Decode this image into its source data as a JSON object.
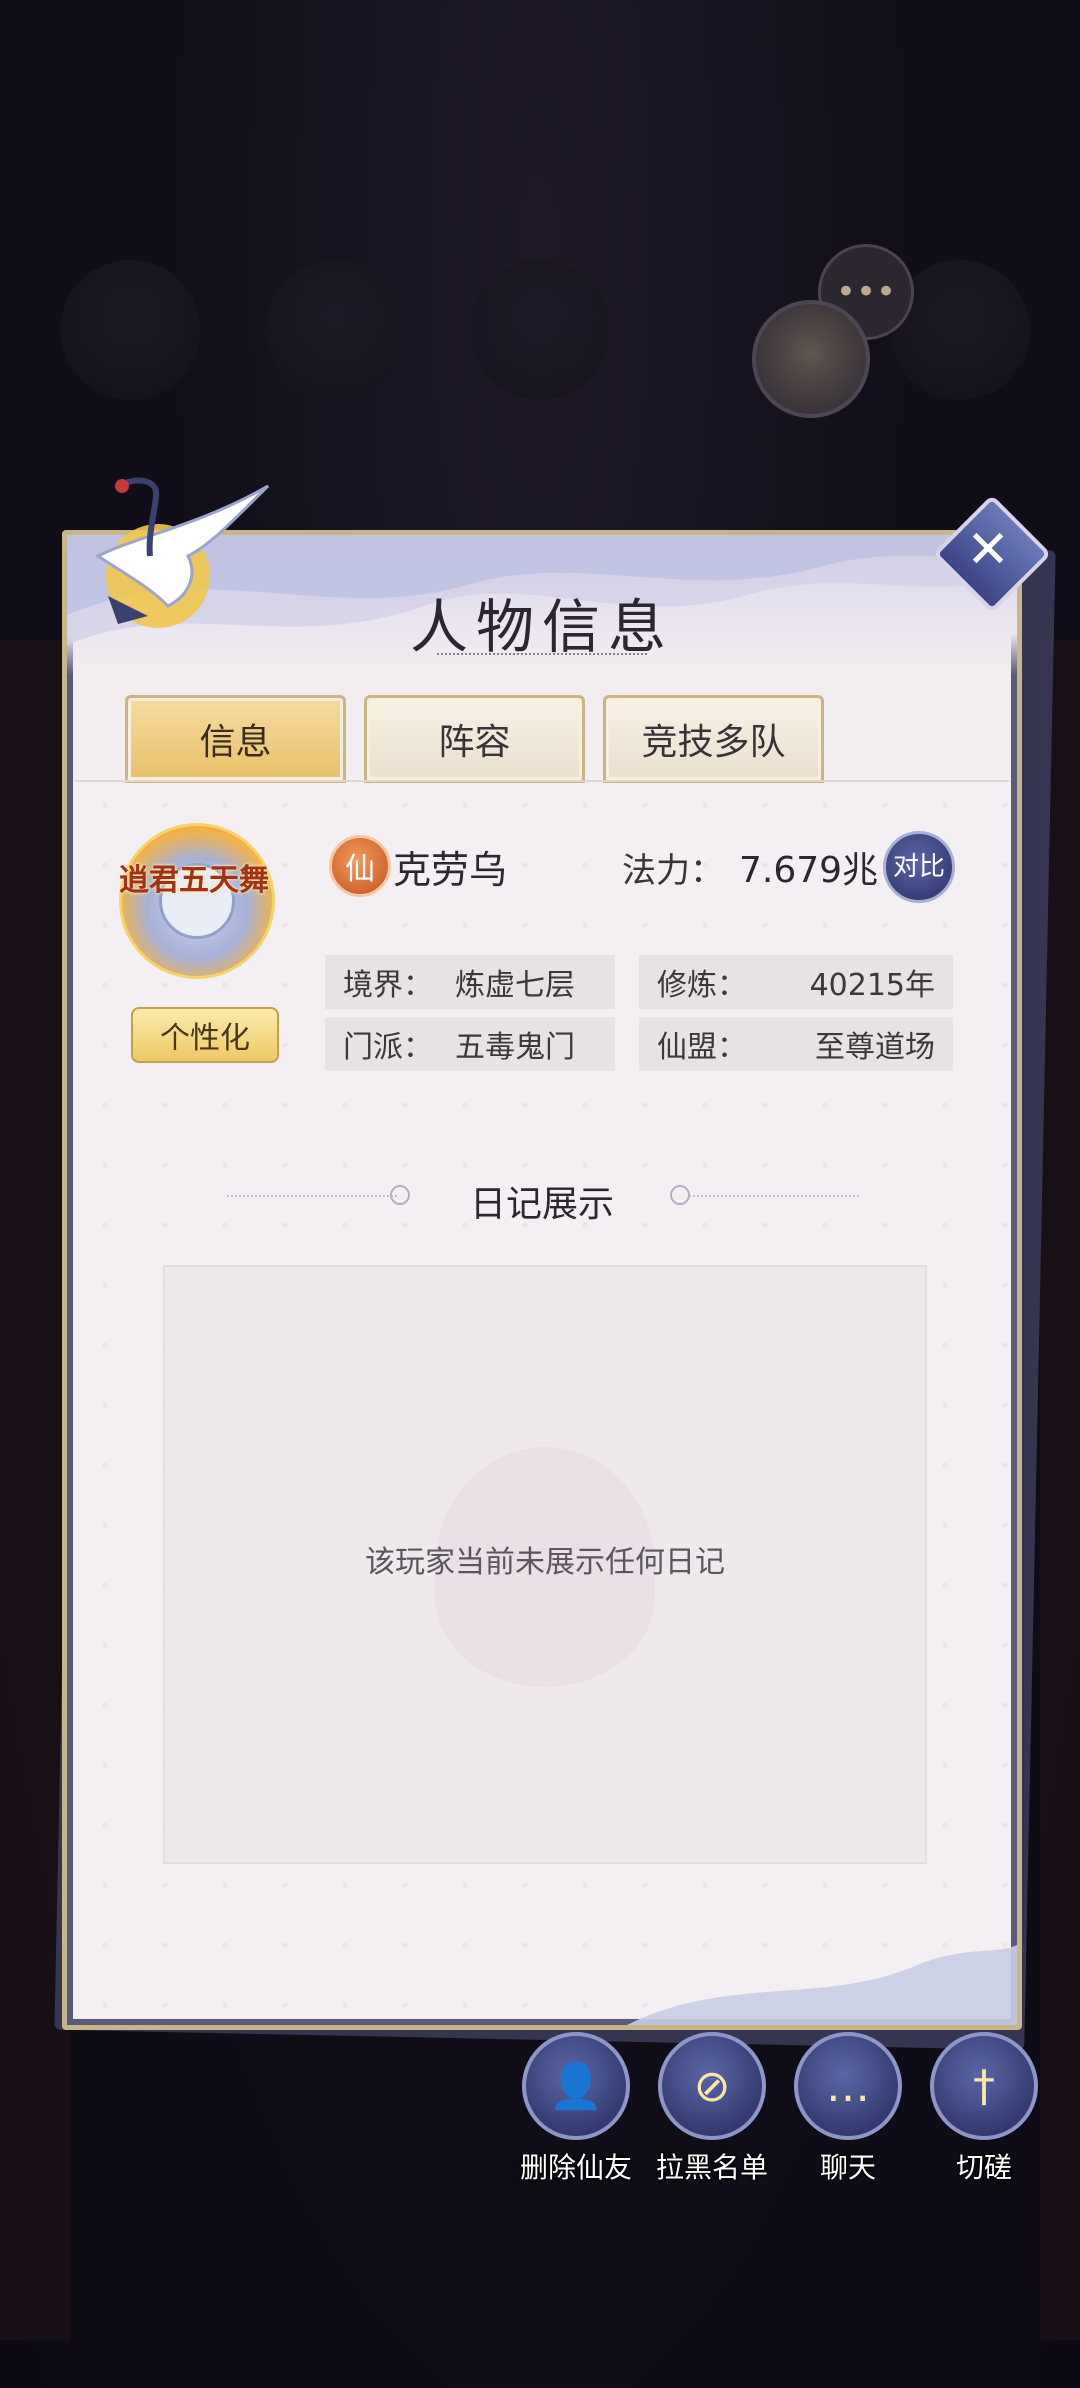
{
  "dialog": {
    "title": "人物信息",
    "tabs": [
      {
        "label": "信息",
        "active": true
      },
      {
        "label": "阵容",
        "active": false
      },
      {
        "label": "竞技多队",
        "active": false
      }
    ]
  },
  "profile": {
    "avatar_tag": "逍君五天舞",
    "personalize_label": "个性化",
    "badge": "仙",
    "name": "克劳乌",
    "power_label": "法力：",
    "power_value": "7.679兆",
    "compare_label": "对比",
    "fields": {
      "realm_label": "境界：",
      "realm_value": "炼虚七层",
      "cultivation_label": "修炼：",
      "cultivation_value": "40215年",
      "sect_label": "门派：",
      "sect_value": "五毒鬼门",
      "alliance_label": "仙盟：",
      "alliance_value": "至尊道场"
    }
  },
  "diary": {
    "title": "日记展示",
    "empty_text": "该玩家当前未展示任何日记"
  },
  "actions": [
    {
      "label": "删除仙友",
      "icon": "remove-friend-icon"
    },
    {
      "label": "拉黑名单",
      "icon": "block-user-icon"
    },
    {
      "label": "聊天",
      "icon": "chat-icon"
    },
    {
      "label": "切磋",
      "icon": "sword-icon"
    }
  ],
  "colors": {
    "tab_active": "#e8c06a",
    "action_button": "#3b4486",
    "panel_bg": "#f3ecef"
  }
}
